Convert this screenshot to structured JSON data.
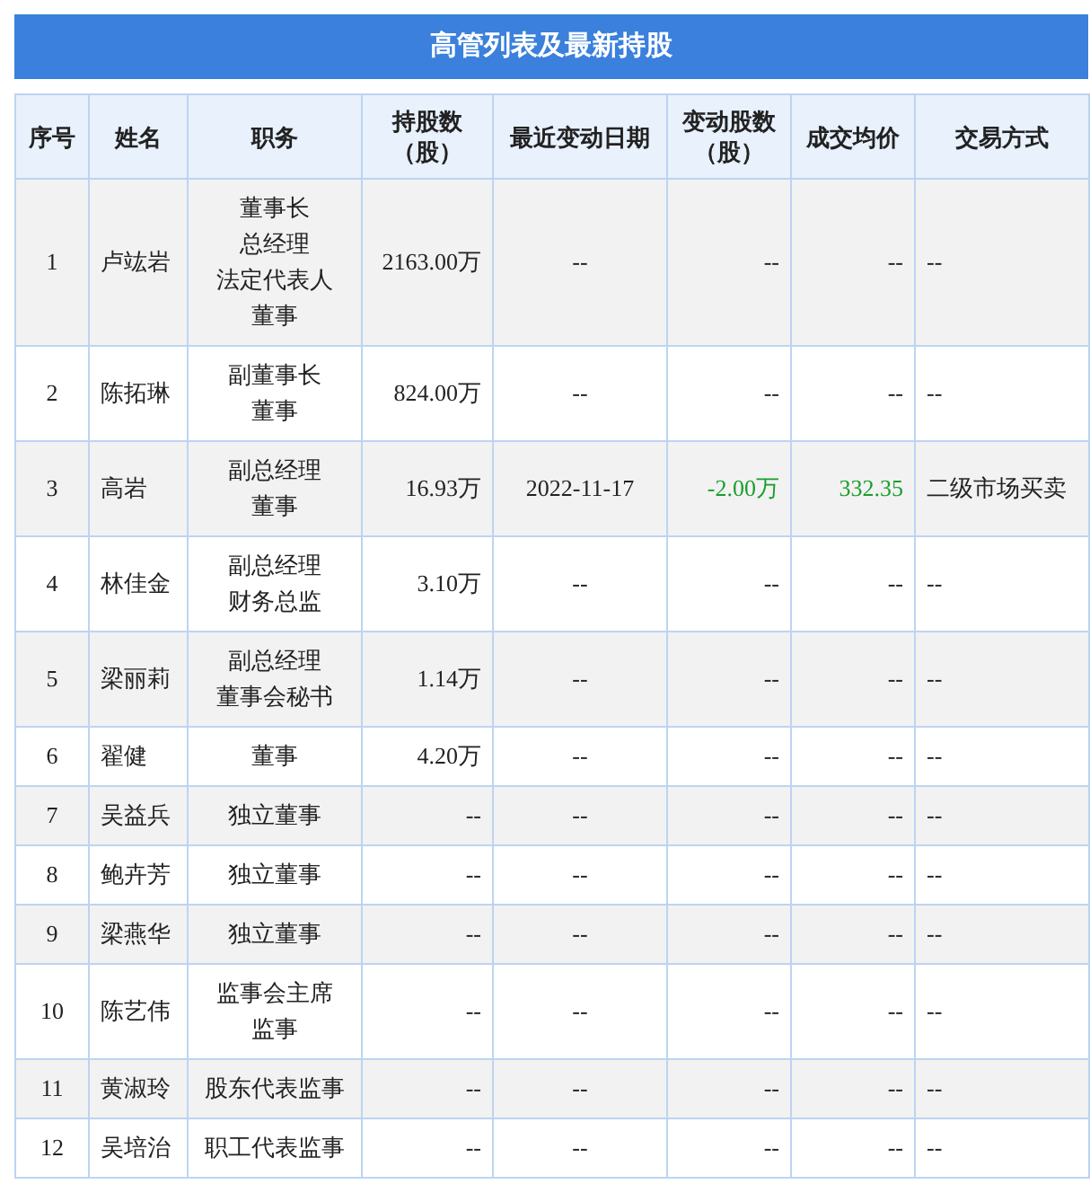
{
  "title": "高管列表及最新持股",
  "columns": [
    {
      "lines": [
        "序号"
      ]
    },
    {
      "lines": [
        "姓名"
      ]
    },
    {
      "lines": [
        "职务"
      ]
    },
    {
      "lines": [
        "持股数",
        "（股）"
      ]
    },
    {
      "lines": [
        "最近变动日期"
      ]
    },
    {
      "lines": [
        "变动股数",
        "（股）"
      ]
    },
    {
      "lines": [
        "成交均价"
      ]
    },
    {
      "lines": [
        "交易方式"
      ]
    }
  ],
  "rows": [
    {
      "no": "1",
      "name": "卢竑岩",
      "roles": [
        "董事长",
        "总经理",
        "法定代表人",
        "董事"
      ],
      "shares": "2163.00万",
      "date": "--",
      "change": "--",
      "price": "--",
      "method": "--"
    },
    {
      "no": "2",
      "name": "陈拓琳",
      "roles": [
        "副董事长",
        "董事"
      ],
      "shares": "824.00万",
      "date": "--",
      "change": "--",
      "price": "--",
      "method": "--"
    },
    {
      "no": "3",
      "name": "高岩",
      "roles": [
        "副总经理",
        "董事"
      ],
      "shares": "16.93万",
      "date": "2022-11-17",
      "change": "-2.00万",
      "price": "332.35",
      "method": "二级市场买卖",
      "color": "#1a9e2c"
    },
    {
      "no": "4",
      "name": "林佳金",
      "roles": [
        "副总经理",
        "财务总监"
      ],
      "shares": "3.10万",
      "date": "--",
      "change": "--",
      "price": "--",
      "method": "--"
    },
    {
      "no": "5",
      "name": "梁丽莉",
      "roles": [
        "副总经理",
        "董事会秘书"
      ],
      "shares": "1.14万",
      "date": "--",
      "change": "--",
      "price": "--",
      "method": "--"
    },
    {
      "no": "6",
      "name": "翟健",
      "roles": [
        "董事"
      ],
      "shares": "4.20万",
      "date": "--",
      "change": "--",
      "price": "--",
      "method": "--"
    },
    {
      "no": "7",
      "name": "吴益兵",
      "roles": [
        "独立董事"
      ],
      "shares": "--",
      "date": "--",
      "change": "--",
      "price": "--",
      "method": "--"
    },
    {
      "no": "8",
      "name": "鲍卉芳",
      "roles": [
        "独立董事"
      ],
      "shares": "--",
      "date": "--",
      "change": "--",
      "price": "--",
      "method": "--"
    },
    {
      "no": "9",
      "name": "梁燕华",
      "roles": [
        "独立董事"
      ],
      "shares": "--",
      "date": "--",
      "change": "--",
      "price": "--",
      "method": "--"
    },
    {
      "no": "10",
      "name": "陈艺伟",
      "roles": [
        "监事会主席",
        "监事"
      ],
      "shares": "--",
      "date": "--",
      "change": "--",
      "price": "--",
      "method": "--"
    },
    {
      "no": "11",
      "name": "黄淑玲",
      "roles": [
        "股东代表监事"
      ],
      "shares": "--",
      "date": "--",
      "change": "--",
      "price": "--",
      "method": "--"
    },
    {
      "no": "12",
      "name": "吴培治",
      "roles": [
        "职工代表监事"
      ],
      "shares": "--",
      "date": "--",
      "change": "--",
      "price": "--",
      "method": "--"
    }
  ]
}
